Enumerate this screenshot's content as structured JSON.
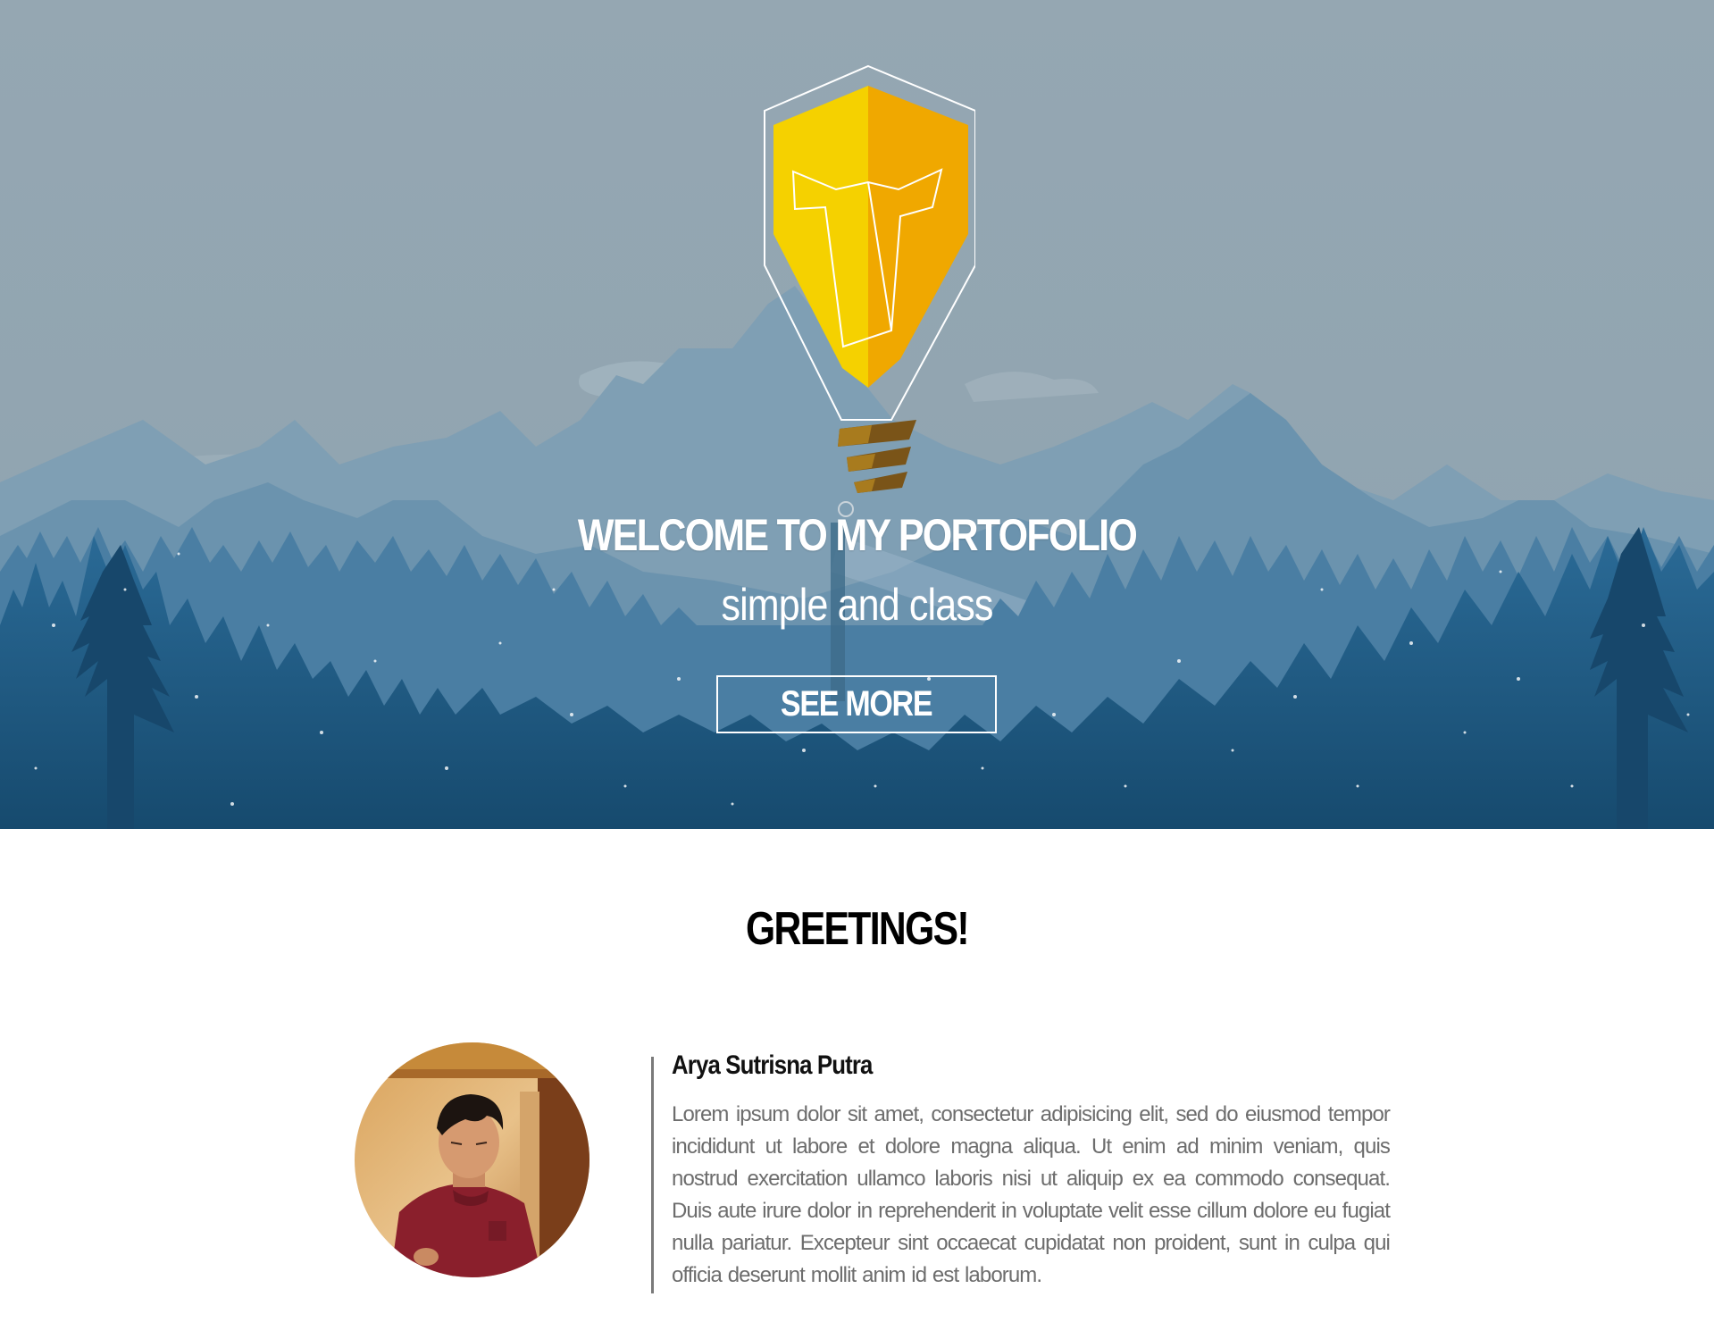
{
  "hero": {
    "title": "WELCOME TO MY PORTOFOLIO",
    "subtitle": "simple and class",
    "cta_label": "SEE MORE",
    "logo_icon": "lightbulb-shield-icon"
  },
  "greetings": {
    "heading": "GREETINGS!",
    "name": "Arya Sutrisna Putra",
    "bio": "Lorem ipsum dolor sit amet, consectetur adipisicing elit, sed do eiusmod tempor incididunt ut labore et dolore magna aliqua. Ut enim ad minim veniam, quis nostrud exercitation ullamco laboris nisi ut aliquip ex ea commodo consequat. Duis aute irure dolor in reprehenderit in voluptate velit esse cillum dolore eu fugiat nulla pariatur. Excepteur sint occaecat cupidatat non proident, sunt in culpa qui officia deserunt mollit anim id est laborum."
  },
  "colors": {
    "sky": "#93a6b1",
    "mountain_far": "#7f9fb5",
    "mountain_mid": "#5f8aa8",
    "forest_mid": "#2f6a93",
    "forest_front": "#1d4f74",
    "bulb_yellow": "#f5d100",
    "bulb_orange": "#f0a800",
    "screw_brown": "#7a5418"
  }
}
